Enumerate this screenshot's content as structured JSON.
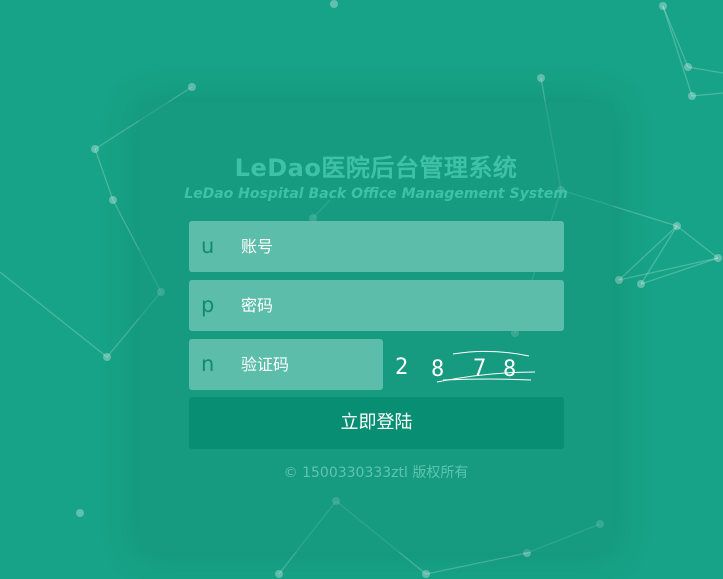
{
  "colors": {
    "background": "#17a387",
    "card": "#1a977e",
    "input": "#5cbeaa",
    "button": "#088f73",
    "title": "#3fc1a6"
  },
  "header": {
    "title": "LeDao医院后台管理系统",
    "subtitle": "LeDao Hospital Back Office Management System"
  },
  "form": {
    "username": {
      "prefix": "u",
      "placeholder": "账号"
    },
    "password": {
      "prefix": "p",
      "placeholder": "密码"
    },
    "captcha": {
      "prefix": "n",
      "placeholder": "验证码",
      "code": [
        "2",
        "8",
        "7",
        "8"
      ]
    },
    "submit_label": "立即登陆"
  },
  "footer": {
    "copyright": "© 1500330333ztl 版权所有"
  }
}
